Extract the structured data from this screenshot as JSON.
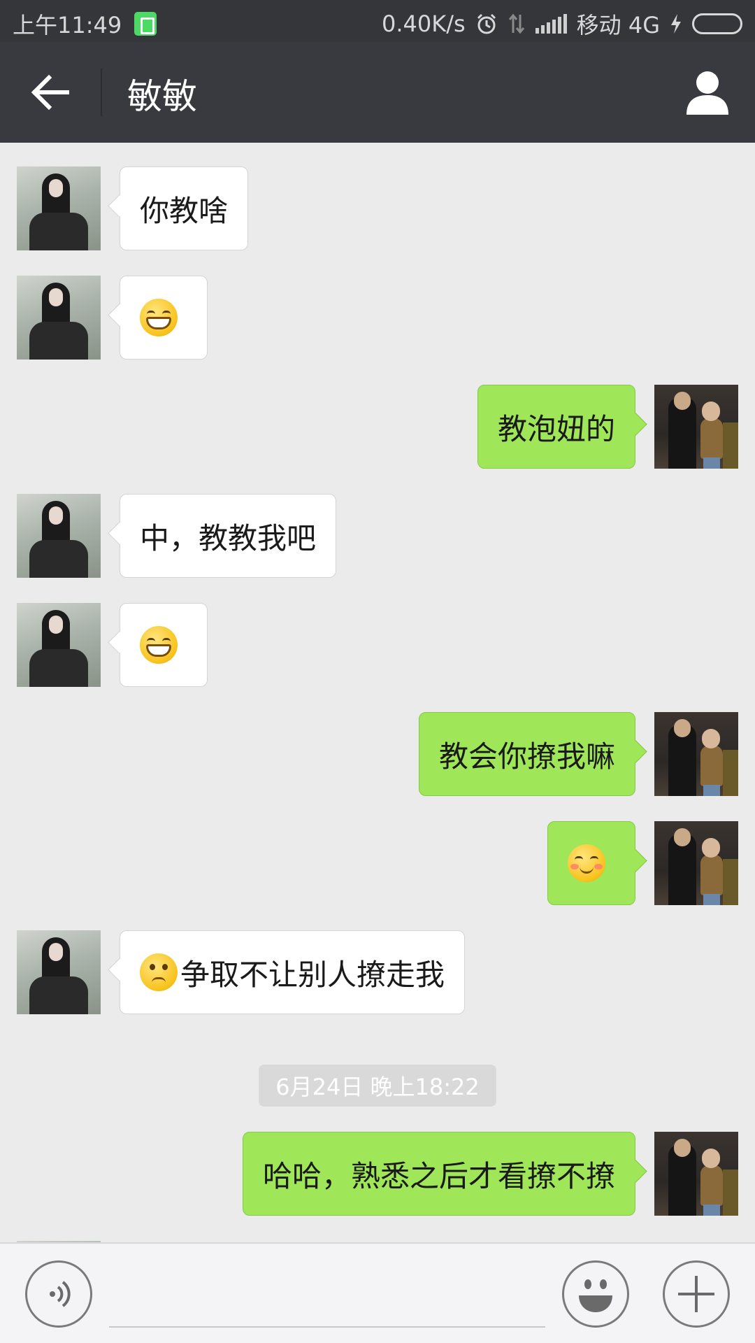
{
  "status_bar": {
    "time": "上午11:49",
    "net_speed": "0.40K/s",
    "carrier": "移动 4G"
  },
  "header": {
    "title": "敏敏"
  },
  "messages": [
    {
      "side": "in",
      "type": "text",
      "text": "你教啥"
    },
    {
      "side": "in",
      "type": "emoji",
      "emoji": "grin"
    },
    {
      "side": "out",
      "type": "text",
      "text": "教泡妞的"
    },
    {
      "side": "in",
      "type": "text",
      "text": "中，教教我吧"
    },
    {
      "side": "in",
      "type": "emoji",
      "emoji": "grin"
    },
    {
      "side": "out",
      "type": "text",
      "text": "教会你撩我嘛"
    },
    {
      "side": "out",
      "type": "emoji",
      "emoji": "blush-smile"
    },
    {
      "side": "in",
      "type": "text",
      "emoji": "confused",
      "text": "争取不让别人撩走我"
    },
    {
      "type": "timestamp",
      "text": "6月24日 晚上18:22"
    },
    {
      "side": "out",
      "type": "text",
      "text": "哈哈，熟悉之后才看撩不撩"
    }
  ],
  "input": {
    "placeholder": "",
    "value": ""
  },
  "colors": {
    "status_bar": "#35363a",
    "title_bar": "#393a3f",
    "chat_bg": "#ebebeb",
    "out_bubble": "#9fe658",
    "in_bubble": "#ffffff"
  }
}
